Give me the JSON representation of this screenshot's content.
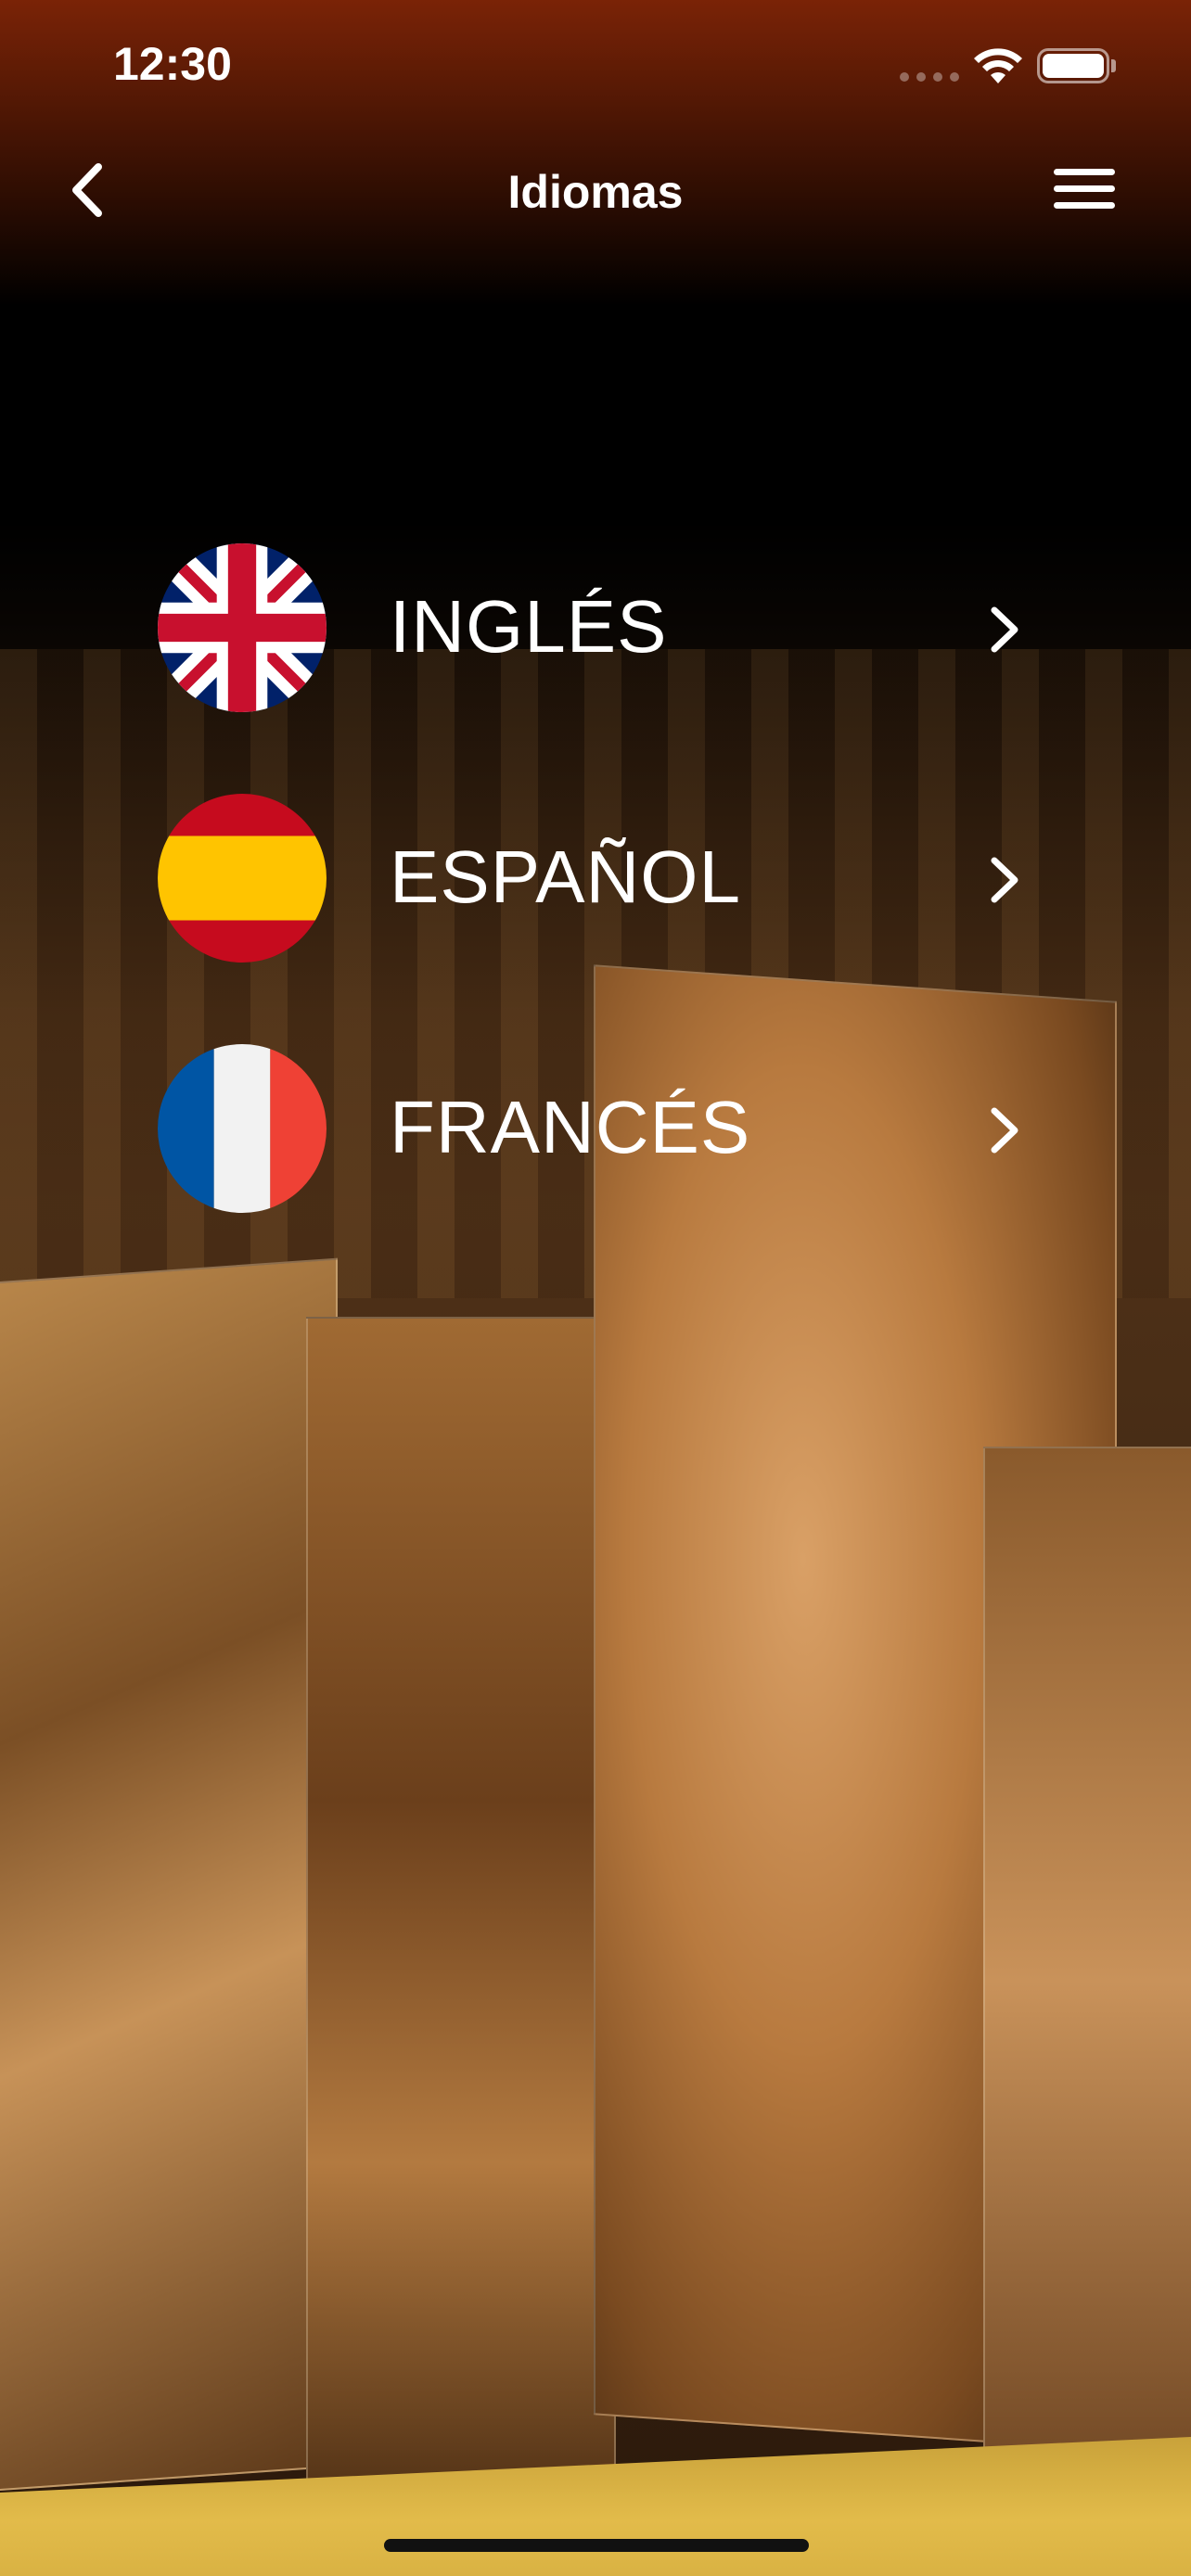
{
  "status_bar": {
    "time": "12:30"
  },
  "nav": {
    "title": "Idiomas",
    "back_icon": "chevron-left-icon",
    "menu_icon": "hamburger-menu-icon"
  },
  "languages": [
    {
      "label": "INGLÉS",
      "flag": "uk-flag-icon"
    },
    {
      "label": "ESPAÑOL",
      "flag": "spain-flag-icon"
    },
    {
      "label": "FRANCÉS",
      "flag": "france-flag-icon"
    }
  ],
  "colors": {
    "header_top": "#7a2306",
    "text": "#ffffff",
    "uk_blue": "#012169",
    "uk_red": "#C8102E",
    "spain_red": "#C60B1E",
    "spain_yellow": "#FFC400",
    "france_blue": "#0055A4",
    "france_white": "#F2F2F2",
    "france_red": "#EF4135"
  }
}
